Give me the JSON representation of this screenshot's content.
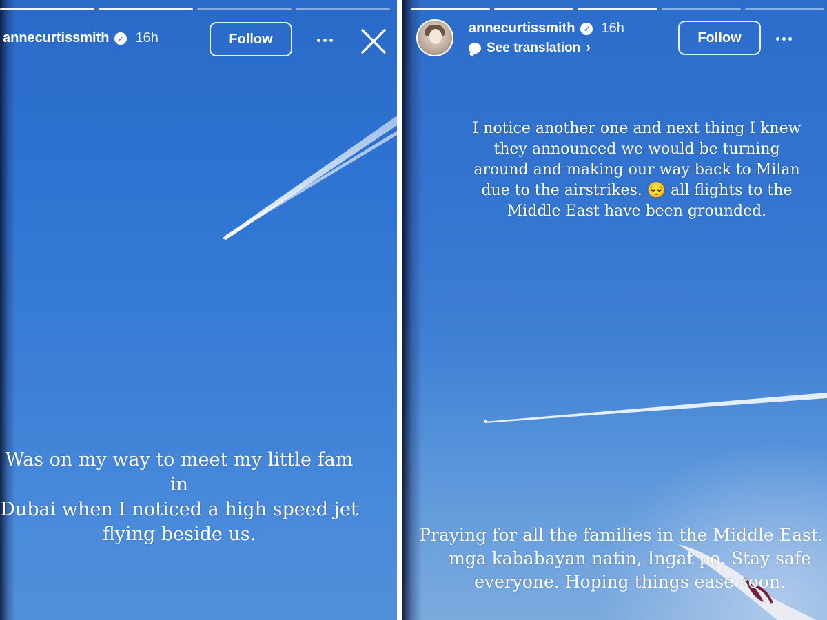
{
  "stories": [
    {
      "progress": {
        "total_segments": 4,
        "completed_segments": 2
      },
      "header": {
        "username": "annecurtissmith",
        "time": "16h",
        "follow_label": "Follow"
      },
      "caption": {
        "lines": [
          "Was on my way to meet my little fam in",
          "Dubai when I noticed a high speed jet",
          "flying beside us."
        ]
      }
    },
    {
      "progress": {
        "total_segments": 5,
        "completed_segments": 3
      },
      "header": {
        "username": "annecurtissmith",
        "time": "16h",
        "see_translation": "See translation",
        "follow_label": "Follow"
      },
      "caption_top": {
        "lines": [
          "I notice another one and next thing I knew",
          "they announced we would be turning",
          "around and making our way back to Milan",
          "due to the airstrikes. 😔 all flights to the",
          "Middle East have been grounded."
        ]
      },
      "caption_bottom": {
        "lines": [
          "Praying for all the families in the Middle East. S",
          "mga kababayan natin, Ingat po. Stay safe",
          "everyone. Hoping things ease soon."
        ]
      }
    }
  ],
  "colors": {
    "sky": "#2e74d2",
    "text": "#ffffff",
    "divider": "#ffffff",
    "wing_accent": "#7a1f3d"
  }
}
